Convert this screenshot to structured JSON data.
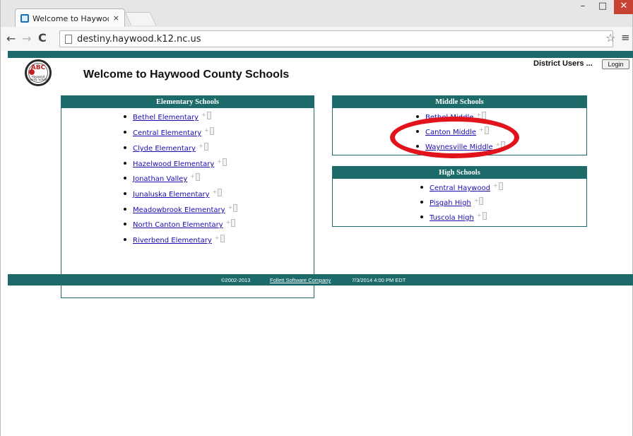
{
  "browser": {
    "tab_title": "Welcome to Haywood Co",
    "tab_close": "×",
    "url": "destiny.haywood.k12.nc.us",
    "window_controls": {
      "minimize": "–",
      "maximize": "□",
      "close": "✕"
    },
    "nav": {
      "back": "←",
      "forward": "→",
      "reload": "C",
      "star": "☆",
      "menu": "≡"
    }
  },
  "header": {
    "logo_text_top": "ABC",
    "logo_text_bottom": "Haywood County Schools",
    "title": "Welcome to Haywood County Schools",
    "district_label": "District Users ...",
    "login_label": "Login"
  },
  "elementary": {
    "heading": "Elementary Schools",
    "items": [
      "Bethel Elementary",
      "Central Elementary",
      "Clyde Elementary",
      "Hazelwood Elementary",
      "Jonathan Valley",
      "Junaluska Elementary",
      "Meadowbrook Elementary",
      "North Canton Elementary",
      "Riverbend Elementary"
    ]
  },
  "middle": {
    "heading": "Middle Schools",
    "items": [
      "Bethel Middle",
      "Canton Middle",
      "Waynesville Middle"
    ]
  },
  "high": {
    "heading": "High Schools",
    "items": [
      "Central Haywood",
      "Pisgah High",
      "Tuscola High"
    ]
  },
  "footer": {
    "copyright": "©2002-2013",
    "company": "Follett Software Company",
    "timestamp": "7/3/2014 4:00 PM EDT"
  },
  "colors": {
    "accent": "#1c6b6a",
    "highlight": "#e1141b",
    "link": "#1a0dab"
  }
}
